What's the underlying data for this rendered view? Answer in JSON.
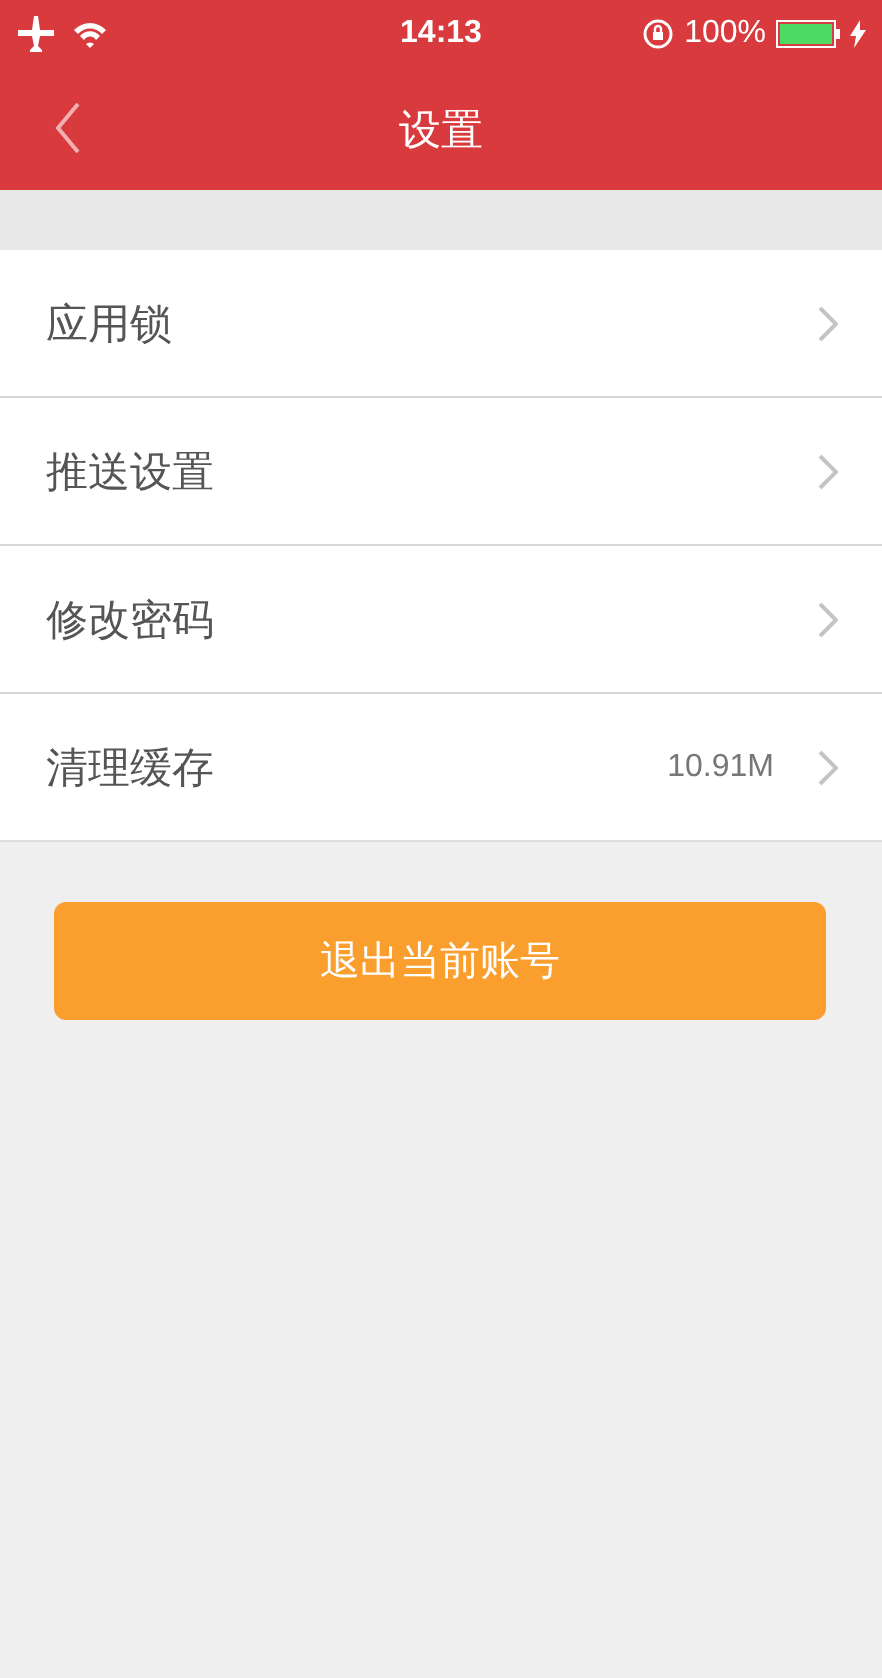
{
  "status_bar": {
    "time": "14:13",
    "battery": "100%"
  },
  "nav": {
    "title": "设置"
  },
  "settings": [
    {
      "label": "应用锁"
    },
    {
      "label": "推送设置"
    },
    {
      "label": "修改密码"
    },
    {
      "label": "清理缓存",
      "value": "10.91M"
    }
  ],
  "logout_button": "退出当前账号"
}
